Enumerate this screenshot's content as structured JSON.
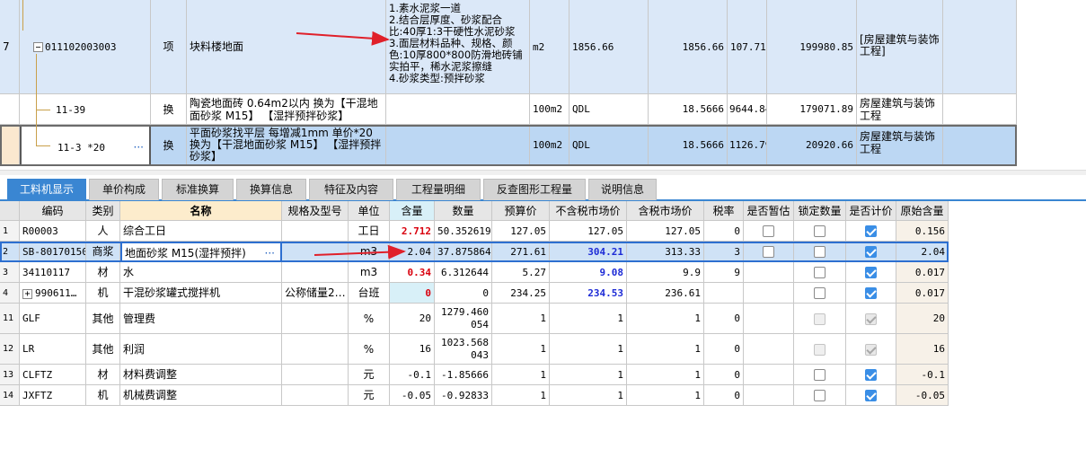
{
  "upper": {
    "row7": {
      "num": "7",
      "code": "011102003003",
      "type": "项",
      "name": "块料楼地面",
      "features": "1.素水泥浆一道\n2.结合层厚度、砂浆配合比:40厚1:3干硬性水泥砂浆\n3.面层材料品种、规格、颜色:10厚800*800防滑地砖铺实拍平，稀水泥浆擦缝\n4.砂浆类型:预拌砂浆",
      "unit": "m2",
      "qty_expr": "1856.66",
      "qty": "1856.66",
      "price": "107.71",
      "total": "199980.85",
      "category": "[房屋建筑与装饰工程]"
    },
    "row_a": {
      "code": "11-39",
      "type": "换",
      "name": "陶瓷地面砖 0.64m2以内  换为【干混地面砂浆 M15】 【湿拌预拌砂浆】",
      "unit": "100m2",
      "qty_expr": "QDL",
      "qty": "18.5666",
      "price": "9644.84",
      "total": "179071.89",
      "category": "房屋建筑与装饰工程"
    },
    "row_b": {
      "code": "11-3 *20",
      "more": "···",
      "type": "换",
      "name": "平面砂浆找平层 每增减1mm  单价*20 换为【干混地面砂浆 M15】 【湿拌预拌砂浆】",
      "unit": "100m2",
      "qty_expr": "QDL",
      "qty": "18.5666",
      "price": "1126.79",
      "total": "20920.66",
      "category": "房屋建筑与装饰工程"
    },
    "collapse_icon": "minus-box-icon"
  },
  "tabs": [
    "工料机显示",
    "单价构成",
    "标准换算",
    "换算信息",
    "特征及内容",
    "工程量明细",
    "反查图形工程量",
    "说明信息"
  ],
  "columns": [
    "编码",
    "类别",
    "名称",
    "规格及型号",
    "单位",
    "含量",
    "数量",
    "预算价",
    "不含税市场价",
    "含税市场价",
    "税率",
    "是否暂估",
    "锁定数量",
    "是否计价",
    "原始含量"
  ],
  "rows": [
    {
      "idx": "1",
      "code": "R00003",
      "cat": "人",
      "name": "综合工日",
      "spec": "",
      "unit": "工日",
      "content": "2.712",
      "qty": "50.352619",
      "budget": "127.05",
      "mkt_ex": "127.05",
      "mkt_in": "127.05",
      "tax": "0",
      "est": "box",
      "lock": "box",
      "price": "on",
      "orig": "0.156",
      "content_style": "red",
      "mkt_style": ""
    },
    {
      "idx": "2",
      "code": "SB-80170150",
      "cat": "商浆",
      "name": "地面砂浆 M15(湿拌预拌)",
      "spec": "",
      "unit": "m3",
      "content": "2.04",
      "qty": "37.875864",
      "budget": "271.61",
      "mkt_ex": "304.21",
      "mkt_in": "313.33",
      "tax": "3",
      "est": "box",
      "lock": "box",
      "price": "on",
      "orig": "2.04",
      "content_style": "",
      "mkt_style": "blue"
    },
    {
      "idx": "3",
      "code": "34110117",
      "cat": "材",
      "name": "水",
      "spec": "",
      "unit": "m3",
      "content": "0.34",
      "qty": "6.312644",
      "budget": "5.27",
      "mkt_ex": "9.08",
      "mkt_in": "9.9",
      "tax": "9",
      "est": "",
      "lock": "box",
      "price": "on",
      "orig": "0.017",
      "content_style": "red",
      "mkt_style": "blue"
    },
    {
      "idx": "4",
      "code": "990611…",
      "cat": "机",
      "name": "干混砂浆罐式搅拌机",
      "spec": "公称储量2…",
      "unit": "台班",
      "content": "0",
      "qty": "0",
      "budget": "234.25",
      "mkt_ex": "234.53",
      "mkt_in": "236.61",
      "tax": "",
      "est": "",
      "lock": "box",
      "price": "on",
      "orig": "0.017",
      "content_style": "red",
      "mkt_style": "blue"
    },
    {
      "idx": "11",
      "code": "GLF",
      "cat": "其他",
      "name": "管理费",
      "spec": "",
      "unit": "%",
      "content": "20",
      "qty": "1279.460054",
      "budget": "1",
      "mkt_ex": "1",
      "mkt_in": "1",
      "tax": "0",
      "est": "",
      "lock": "dis",
      "price": "dison",
      "orig": "20",
      "content_style": "",
      "mkt_style": ""
    },
    {
      "idx": "12",
      "code": "LR",
      "cat": "其他",
      "name": "利润",
      "spec": "",
      "unit": "%",
      "content": "16",
      "qty": "1023.568043",
      "budget": "1",
      "mkt_ex": "1",
      "mkt_in": "1",
      "tax": "0",
      "est": "",
      "lock": "dis",
      "price": "dison",
      "orig": "16",
      "content_style": "",
      "mkt_style": ""
    },
    {
      "idx": "13",
      "code": "CLFTZ",
      "cat": "材",
      "name": "材料费调整",
      "spec": "",
      "unit": "元",
      "content": "-0.1",
      "qty": "-1.85666",
      "budget": "1",
      "mkt_ex": "1",
      "mkt_in": "1",
      "tax": "0",
      "est": "",
      "lock": "box",
      "price": "on",
      "orig": "-0.1",
      "content_style": "",
      "mkt_style": ""
    },
    {
      "idx": "14",
      "code": "JXFTZ",
      "cat": "机",
      "name": "机械费调整",
      "spec": "",
      "unit": "元",
      "content": "-0.05",
      "qty": "-0.92833",
      "budget": "1",
      "mkt_ex": "1",
      "mkt_in": "1",
      "tax": "0",
      "est": "",
      "lock": "box",
      "price": "on",
      "orig": "-0.05",
      "content_style": "",
      "mkt_style": ""
    }
  ],
  "row4_expand": "+",
  "row2_more": "···",
  "colors": {
    "selected_row": "#cfe2f6",
    "tab_active": "#3a86d2",
    "arrow": "#e0202a",
    "highlight_cell": "#d8f0f8"
  }
}
